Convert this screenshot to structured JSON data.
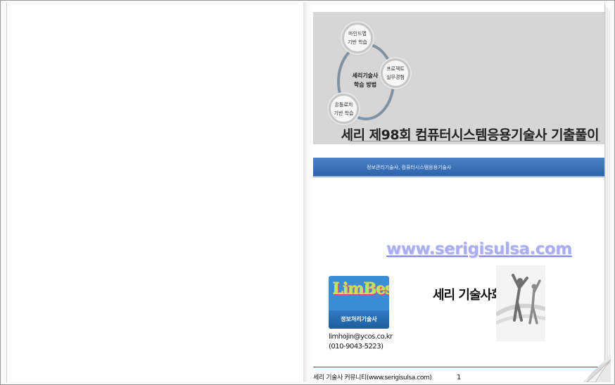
{
  "cover": {
    "title": "세리 제98회 컴퓨터시스템응용기술사 기출풀이",
    "diagram": {
      "center": "세리기술사\n학습 방법",
      "nodes": [
        "마인드맵\n기반 학습",
        "프로젝트\n실무경험",
        "온톨로지\n기반 학습"
      ]
    },
    "band_text": "정보관리기술사, 컴퓨터시스템응용기술사",
    "url": "www.serigisulsa.com",
    "logo": {
      "name": "LimBest",
      "subtitle": "정보처리기술사"
    },
    "contact": {
      "email": "limhojin@ycos.co.kr",
      "phone": "(010-9043-5223)"
    },
    "community_name": "세리 기술사회",
    "footer": "세리 기술사 커뮤니티(www.serigisulsa.com)",
    "page_number": "1"
  },
  "colors": {
    "band_blue": "#2d63a9",
    "header_gray": "#d6d6d6",
    "url_lavender": "#a8aef0",
    "ring_slate": "#7f93a4"
  },
  "icons": [
    "page-curl-icon",
    "celebration-silhouette-icon"
  ]
}
